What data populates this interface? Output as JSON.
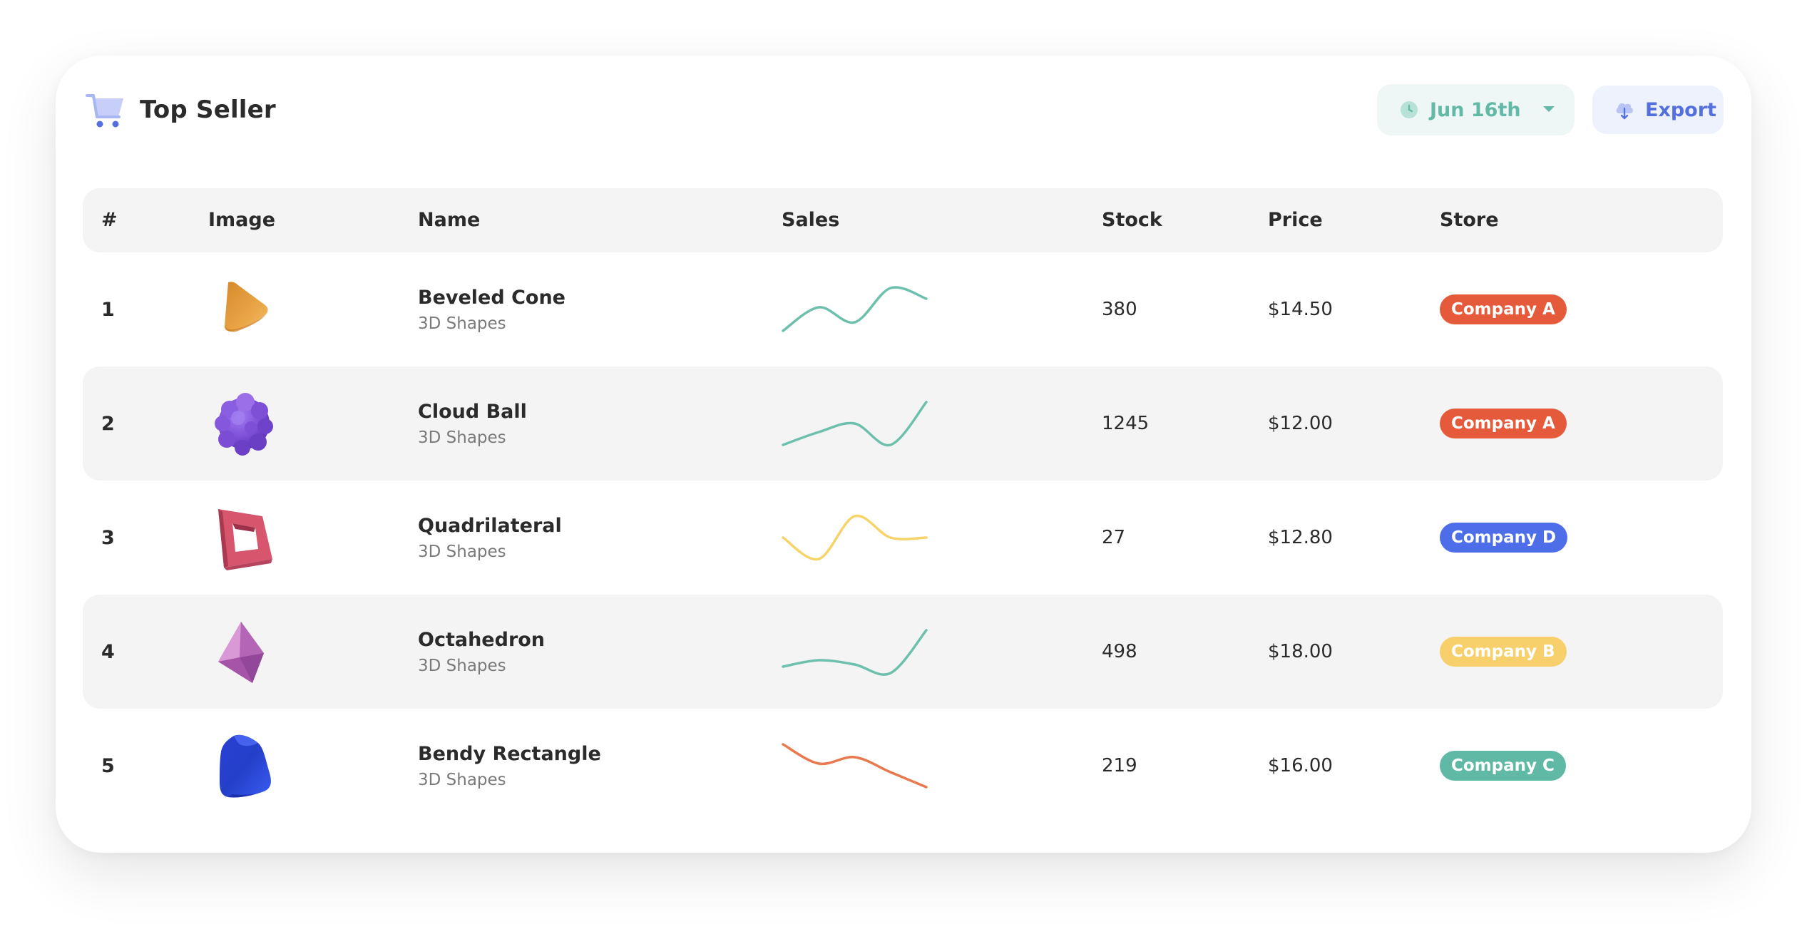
{
  "header": {
    "title": "Top Seller",
    "date_label": "Jun 16th",
    "export_label": "Export"
  },
  "columns": {
    "rank": "#",
    "image": "Image",
    "name": "Name",
    "sales": "Sales",
    "stock": "Stock",
    "price": "Price",
    "store": "Store"
  },
  "colors": {
    "accent_teal": "#62b9a5",
    "accent_blue": "#5470e0",
    "company_a": "#e55a3a",
    "company_b": "#f7d06b",
    "company_c": "#5fb9a4",
    "company_d": "#4d6ee8"
  },
  "rows": [
    {
      "rank": "1",
      "image_icon": "beveled-cone-icon",
      "name": "Beveled Cone",
      "category": "3D Shapes",
      "stock": "380",
      "price": "$14.50",
      "store": "Company A",
      "store_color": "#e55a3a",
      "sales_color": "#6cc0ac",
      "sales_trend": [
        0.0,
        0.55,
        0.2,
        1.0,
        0.75
      ]
    },
    {
      "rank": "2",
      "image_icon": "cloud-ball-icon",
      "name": "Cloud Ball",
      "category": "3D Shapes",
      "stock": "1245",
      "price": "$12.00",
      "store": "Company A",
      "store_color": "#e55a3a",
      "sales_color": "#6cc0ac",
      "sales_trend": [
        0.0,
        0.3,
        0.5,
        0.0,
        1.0
      ]
    },
    {
      "rank": "3",
      "image_icon": "quadrilateral-icon",
      "name": "Quadrilateral",
      "category": "3D Shapes",
      "stock": "27",
      "price": "$12.80",
      "store": "Company D",
      "store_color": "#4d6ee8",
      "sales_color": "#f6d46a",
      "sales_trend": [
        0.5,
        0.0,
        1.0,
        0.5,
        0.5
      ]
    },
    {
      "rank": "4",
      "image_icon": "octahedron-icon",
      "name": "Octahedron",
      "category": "3D Shapes",
      "stock": "498",
      "price": "$18.00",
      "store": "Company B",
      "store_color": "#f7d06b",
      "sales_color": "#6cc0ac",
      "sales_trend": [
        0.15,
        0.3,
        0.2,
        0.0,
        1.0
      ]
    },
    {
      "rank": "5",
      "image_icon": "bendy-rectangle-icon",
      "name": "Bendy Rectangle",
      "category": "3D Shapes",
      "stock": "219",
      "price": "$16.00",
      "store": "Company C",
      "store_color": "#5fb9a4",
      "sales_color": "#e8794e",
      "sales_trend": [
        1.0,
        0.55,
        0.7,
        0.35,
        0.0
      ]
    }
  ]
}
